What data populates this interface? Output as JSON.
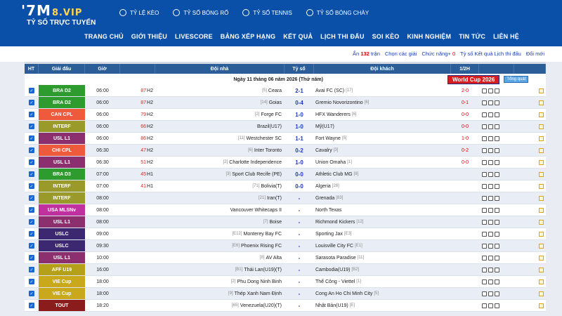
{
  "brand": {
    "logo_main": "'7M",
    "logo_vip": "8.VIP",
    "tagline": "TỶ SỐ TRỰC TUYẾN"
  },
  "topnav": [
    {
      "label": "TỶ LỆ KÈO",
      "icon": "ball-icon"
    },
    {
      "label": "TỶ SỐ BÓNG RỔ",
      "icon": "basketball-icon"
    },
    {
      "label": "TỶ SỐ TENNIS",
      "icon": "tennis-icon"
    },
    {
      "label": "TỶ SỐ BÓNG CHÀY",
      "icon": "baseball-icon"
    }
  ],
  "mainnav": [
    "TRANG CHỦ",
    "GIỚI THIỆU",
    "LIVESCORE",
    "BẢNG XẾP HẠNG",
    "KẾT QUẢ",
    "LỊCH THI ĐẤU",
    "SOI KÈO",
    "KINH NGHIỆM",
    "TIN TỨC",
    "LIÊN HỆ"
  ],
  "toolbar": {
    "hide_label": "Ẩn",
    "hidden_count": "132",
    "hidden_suffix": "trận",
    "choose_league": "Chọn các giải",
    "features": "Chức năng+",
    "features_count": "0",
    "odds": "Tỷ số Kết quả Lịch thi đấu",
    "change": "Đổi mới"
  },
  "columns": {
    "ht": "HT",
    "league": "Giải đấu",
    "time": "Giờ",
    "home": "Đội nhà",
    "score": "Tỷ số",
    "away": "Đội khách",
    "half": "1/2H"
  },
  "date_label": "Ngày 11 tháng 06 năm 2026 (Thứ năm)",
  "worldcup": {
    "label": "World Cup 2026",
    "button": "Tổng quát"
  },
  "colors": {
    "header": "#0a4fa8",
    "table_header": "#2b5d99"
  },
  "matches": [
    {
      "league": "BRA D2",
      "color": "#2e9b2e",
      "time": "06:00",
      "min": "87",
      "half": "H2",
      "home_rank": "[5]",
      "home": "Ceara",
      "score": "2-1",
      "away": "Avai FC (SC)",
      "away_rank": "[17]",
      "ht": "2-0"
    },
    {
      "league": "BRA D2",
      "color": "#2e9b2e",
      "time": "06:00",
      "min": "87",
      "half": "H2",
      "home_rank": "[14]",
      "home": "Goias",
      "score": "0-4",
      "away": "Gremio Novorizontino",
      "away_rank": "[6]",
      "ht": "0-1"
    },
    {
      "league": "CAN CPL",
      "color": "#f05a3c",
      "time": "06:00",
      "min": "79",
      "half": "H2",
      "home_rank": "[2]",
      "home": "Forge FC",
      "score": "1-0",
      "away": "HFX Wanderers",
      "away_rank": "[6]",
      "ht": "0-0"
    },
    {
      "league": "INTERF",
      "color": "#9a9a2a",
      "time": "06:00",
      "min": "66",
      "half": "H2",
      "home_rank": "",
      "home": "Brazil(U17)",
      "score": "1-0",
      "away": "Mỹ(U17)",
      "away_rank": "",
      "ht": "0-0"
    },
    {
      "league": "USL L1",
      "color": "#8b2f6e",
      "time": "06:00",
      "min": "86",
      "half": "H2",
      "home_rank": "[11]",
      "home": "Westchester SC",
      "score": "1-1",
      "away": "Fort Wayne",
      "away_rank": "[5]",
      "ht": "1-0"
    },
    {
      "league": "CHI CPL",
      "color": "#f05a3c",
      "time": "06:30",
      "min": "47",
      "half": "H2",
      "home_rank": "[6]",
      "home": "Inter Toronto",
      "score": "0-2",
      "away": "Cavalry",
      "away_rank": "[3]",
      "ht": "0-2"
    },
    {
      "league": "USL L1",
      "color": "#8b2f6e",
      "time": "06:30",
      "min": "51",
      "half": "H2",
      "home_rank": "[2]",
      "home": "Charlotte Independence",
      "score": "1-0",
      "away": "Union Omaha",
      "away_rank": "[1]",
      "ht": "0-0"
    },
    {
      "league": "BRA D3",
      "color": "#2e9b2e",
      "time": "07:00",
      "min": "45",
      "half": "H1",
      "home_rank": "[3]",
      "home": "Sport Club Recife (PE)",
      "score": "0-0",
      "away": "Athletic Club MG",
      "away_rank": "[8]",
      "ht": ""
    },
    {
      "league": "INTERF",
      "color": "#9a9a2a",
      "time": "07:00",
      "min": "41",
      "half": "H1",
      "home_rank": "[71]",
      "home": "Bolivia(T)",
      "score": "0-0",
      "away": "Algeria",
      "away_rank": "[28]",
      "ht": ""
    },
    {
      "league": "INTERF",
      "color": "#9a9a2a",
      "time": "08:00",
      "min": "",
      "half": "",
      "home_rank": "[21]",
      "home": "Iran(T)",
      "score": "-",
      "away": "Grenada",
      "away_rank": "[83]",
      "ht": ""
    },
    {
      "league": "USA MLSNv",
      "color": "#c0309e",
      "time": "08:00",
      "min": "",
      "half": "",
      "home_rank": "",
      "home": "Vancouver Whitecaps II",
      "score": "-",
      "away": "North Texas",
      "away_rank": "",
      "ht": ""
    },
    {
      "league": "USL L1",
      "color": "#8b2f6e",
      "time": "08:00",
      "min": "",
      "half": "",
      "home_rank": "[7]",
      "home": "Boise",
      "score": "-",
      "away": "Richmond Kickers",
      "away_rank": "[12]",
      "ht": ""
    },
    {
      "league": "USLC",
      "color": "#3b2870",
      "time": "09:00",
      "min": "",
      "half": "",
      "home_rank": "[E12]",
      "home": "Monterey Bay FC",
      "score": "-",
      "away": "Sporting Jax",
      "away_rank": "[E3]",
      "ht": ""
    },
    {
      "league": "USLC",
      "color": "#3b2870",
      "time": "09:30",
      "min": "",
      "half": "",
      "home_rank": "[E6]",
      "home": "Phoenix Rising FC",
      "score": "-",
      "away": "Louisville City FC",
      "away_rank": "[E1]",
      "ht": ""
    },
    {
      "league": "USL L1",
      "color": "#8b2f6e",
      "time": "10:00",
      "min": "",
      "half": "",
      "home_rank": "[8]",
      "home": "AV Alta",
      "score": "-",
      "away": "Sarasota Paradise",
      "away_rank": "[11]",
      "ht": ""
    },
    {
      "league": "AFF U19",
      "color": "#b5a01a",
      "time": "16:00",
      "min": "",
      "half": "",
      "home_rank": "[B1]",
      "home": "Thái Lan(U19)(T)",
      "score": "-",
      "away": "Cambodia(U19)",
      "away_rank": "[B2]",
      "ht": ""
    },
    {
      "league": "VIE Cup",
      "color": "#c9a81c",
      "time": "18:00",
      "min": "",
      "half": "",
      "home_rank": "[2]",
      "home": "Phu Dong Ninh Binh",
      "score": "-",
      "away": "Thể Công - Viettel",
      "away_rank": "[1]",
      "ht": ""
    },
    {
      "league": "VIE Cup",
      "color": "#c9a81c",
      "time": "18:00",
      "min": "",
      "half": "",
      "home_rank": "[9]",
      "home": "Thép Xanh Nam Định",
      "score": "-",
      "away": "Cong An Ho Chi Minh City",
      "away_rank": "[5]",
      "ht": ""
    },
    {
      "league": "TOUT",
      "color": "#8a1c1c",
      "time": "18:20",
      "min": "",
      "half": "",
      "home_rank": "[65]",
      "home": "Venezuela(U20)(T)",
      "score": "-",
      "away": "Nhật Bản(U19)",
      "away_rank": "[E]",
      "ht": ""
    }
  ]
}
